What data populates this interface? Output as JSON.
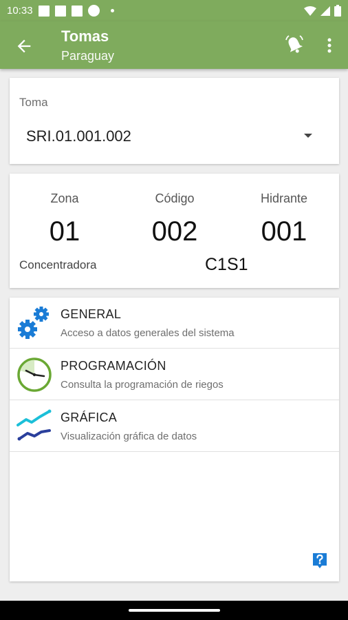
{
  "status_bar": {
    "time": "10:33"
  },
  "app_bar": {
    "title": "Tomas",
    "subtitle": "Paraguay"
  },
  "toma": {
    "label": "Toma",
    "selected_value": "SRI.01.001.002"
  },
  "info": {
    "zona_label": "Zona",
    "zona_value": "01",
    "codigo_label": "Código",
    "codigo_value": "002",
    "hidrante_label": "Hidrante",
    "hidrante_value": "001",
    "concentradora_label": "Concentradora",
    "concentradora_value": "C1S1"
  },
  "menu": {
    "items": [
      {
        "title": "GENERAL",
        "description": "Acceso a datos generales del sistema",
        "icon": "gears-icon"
      },
      {
        "title": "PROGRAMACIÓN",
        "description": "Consulta la programación de riegos",
        "icon": "clock-icon"
      },
      {
        "title": "GRÁFICA",
        "description": "Visualización gráfica de datos",
        "icon": "chart-lines-icon"
      }
    ]
  },
  "colors": {
    "primary": "#7fab5d",
    "accent_blue": "#1a7cd6",
    "clock_green": "#6aa834",
    "chart_cyan": "#1bbfd8",
    "chart_navy": "#2a3f9c"
  }
}
